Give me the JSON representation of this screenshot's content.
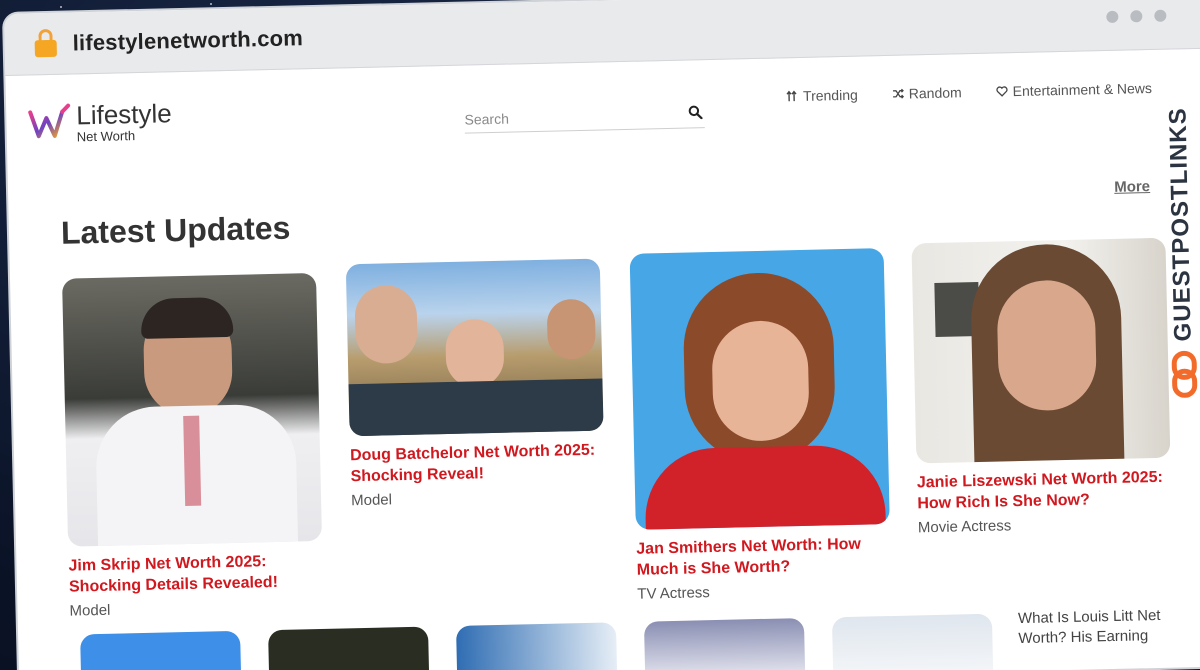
{
  "browser": {
    "url": "lifestylenetworth.com"
  },
  "header": {
    "logo_main": "Lifestyle",
    "logo_sub": "Net Worth",
    "search_placeholder": "Search",
    "nav": [
      {
        "label": "Trending",
        "icon": "trending-arrows-icon"
      },
      {
        "label": "Random",
        "icon": "shuffle-icon"
      },
      {
        "label": "Entertainment & News",
        "icon": "heart-icon"
      }
    ]
  },
  "main": {
    "section_title": "Latest Updates",
    "more_label": "More",
    "cards": [
      {
        "title": "Jim Skrip Net Worth 2025: Shocking Details Revealed!",
        "category": "Model"
      },
      {
        "title": "Doug Batchelor Net Worth 2025: Shocking Reveal!",
        "category": "Model"
      },
      {
        "title": "Jan Smithers Net Worth: How Much is She Worth?",
        "category": "TV Actress"
      },
      {
        "title": "Janie Liszewski Net Worth 2025: How Rich Is She Now?",
        "category": "Movie Actress"
      }
    ],
    "broken_image_alt": "What Is Louis Litt Net Worth? His Earning"
  },
  "watermark": {
    "text": "GUESTPOSTLINKS"
  },
  "colors": {
    "accent_red": "#d0181f",
    "lock": "#f5a623",
    "watermark_orange": "#f26b2a"
  }
}
